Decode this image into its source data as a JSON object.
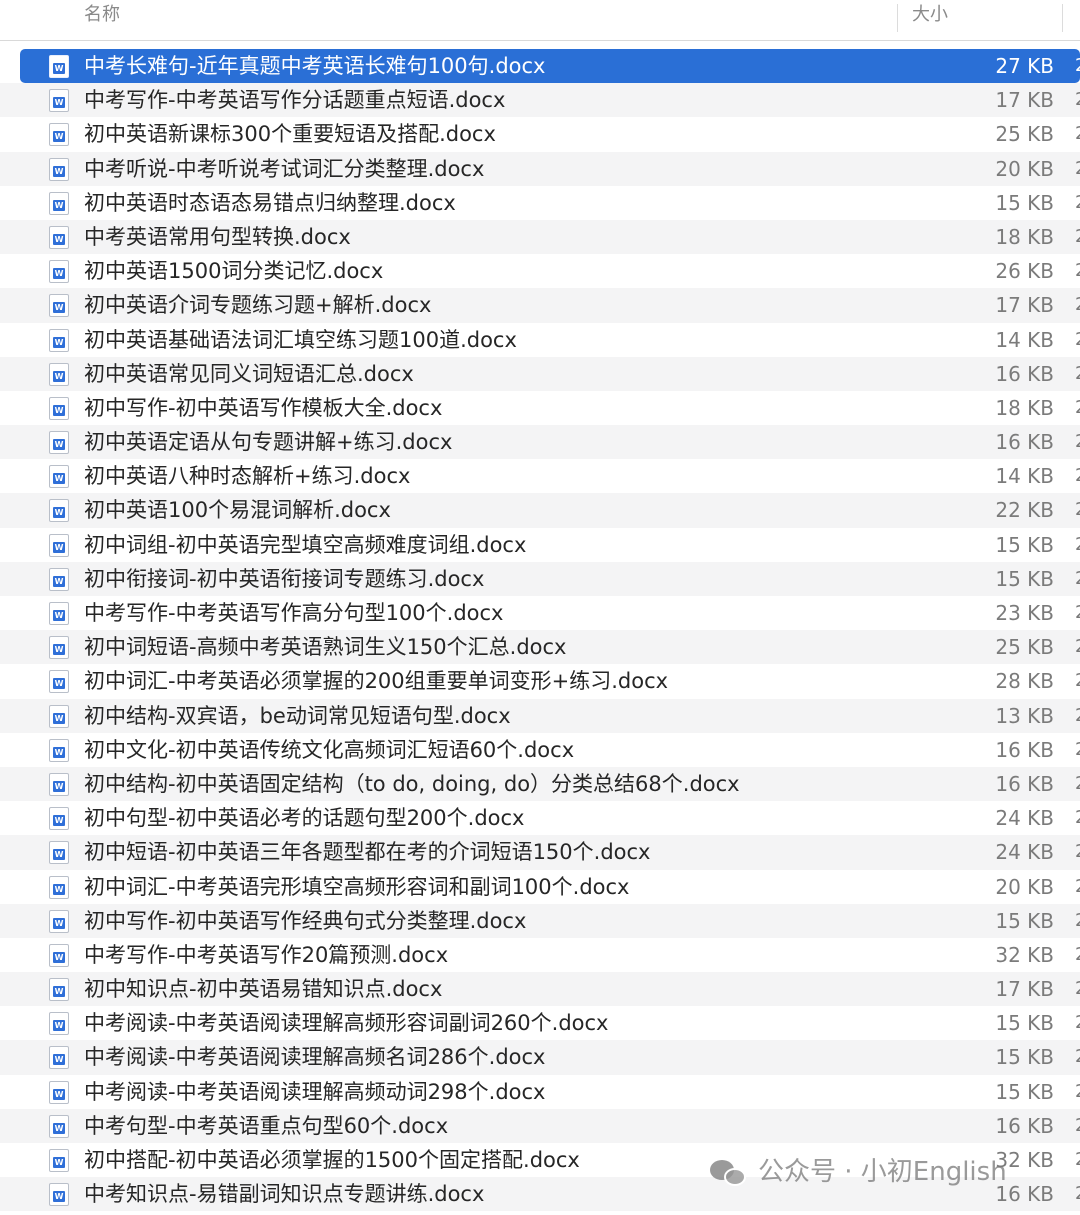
{
  "header": {
    "name_label": "名称",
    "size_label": "大小"
  },
  "files": [
    {
      "name": "中考长难句-近年真题中考英语长难句100句.docx",
      "size": "27 KB",
      "selected": true
    },
    {
      "name": "中考写作-中考英语写作分话题重点短语.docx",
      "size": "17 KB"
    },
    {
      "name": "初中英语新课标300个重要短语及搭配.docx",
      "size": "25 KB"
    },
    {
      "name": "中考听说-中考听说考试词汇分类整理.docx",
      "size": "20 KB"
    },
    {
      "name": "初中英语时态语态易错点归纳整理.docx",
      "size": "15 KB"
    },
    {
      "name": "中考英语常用句型转换.docx",
      "size": "18 KB"
    },
    {
      "name": "初中英语1500词分类记忆.docx",
      "size": "26 KB"
    },
    {
      "name": "初中英语介词专题练习题+解析.docx",
      "size": "17 KB"
    },
    {
      "name": "初中英语基础语法词汇填空练习题100道.docx",
      "size": "14 KB"
    },
    {
      "name": "初中英语常见同义词短语汇总.docx",
      "size": "16 KB"
    },
    {
      "name": "初中写作-初中英语写作模板大全.docx",
      "size": "18 KB"
    },
    {
      "name": "初中英语定语从句专题讲解+练习.docx",
      "size": "16 KB"
    },
    {
      "name": "初中英语八种时态解析+练习.docx",
      "size": "14 KB"
    },
    {
      "name": "初中英语100个易混词解析.docx",
      "size": "22 KB"
    },
    {
      "name": "初中词组-初中英语完型填空高频难度词组.docx",
      "size": "15 KB"
    },
    {
      "name": "初中衔接词-初中英语衔接词专题练习.docx",
      "size": "15 KB"
    },
    {
      "name": "中考写作-中考英语写作高分句型100个.docx",
      "size": "23 KB"
    },
    {
      "name": "初中词短语-高频中考英语熟词生义150个汇总.docx",
      "size": "25 KB"
    },
    {
      "name": "初中词汇-中考英语必须掌握的200组重要单词变形+练习.docx",
      "size": "28 KB"
    },
    {
      "name": "初中结构-双宾语，be动词常见短语句型.docx",
      "size": "13 KB"
    },
    {
      "name": "初中文化-初中英语传统文化高频词汇短语60个.docx",
      "size": "16 KB"
    },
    {
      "name": "初中结构-初中英语固定结构（to do, doing, do）分类总结68个.docx",
      "size": "16 KB"
    },
    {
      "name": "初中句型-初中英语必考的话题句型200个.docx",
      "size": "24 KB"
    },
    {
      "name": "初中短语-初中英语三年各题型都在考的介词短语150个.docx",
      "size": "24 KB"
    },
    {
      "name": "初中词汇-中考英语完形填空高频形容词和副词100个.docx",
      "size": "20 KB"
    },
    {
      "name": "初中写作-初中英语写作经典句式分类整理.docx",
      "size": "15 KB"
    },
    {
      "name": "中考写作-中考英语写作20篇预测.docx",
      "size": "32 KB"
    },
    {
      "name": "初中知识点-初中英语易错知识点.docx",
      "size": "17 KB"
    },
    {
      "name": "中考阅读-中考英语阅读理解高频形容词副词260个.docx",
      "size": "15 KB"
    },
    {
      "name": "中考阅读-中考英语阅读理解高频名词286个.docx",
      "size": "15 KB"
    },
    {
      "name": "中考阅读-中考英语阅读理解高频动词298个.docx",
      "size": "15 KB"
    },
    {
      "name": "中考句型-中考英语重点句型60个.docx",
      "size": "16 KB"
    },
    {
      "name": "初中搭配-初中英语必须掌握的1500个固定搭配.docx",
      "size": "32 KB"
    },
    {
      "name": "中考知识点-易错副词知识点专题讲练.docx",
      "size": "16 KB"
    }
  ],
  "icons": {
    "file": "word-doc-icon"
  },
  "colors": {
    "selection": "#2a6fd6",
    "alt_row": "#f4f4f5"
  },
  "watermark": {
    "text": "公众号 · 小初English"
  }
}
